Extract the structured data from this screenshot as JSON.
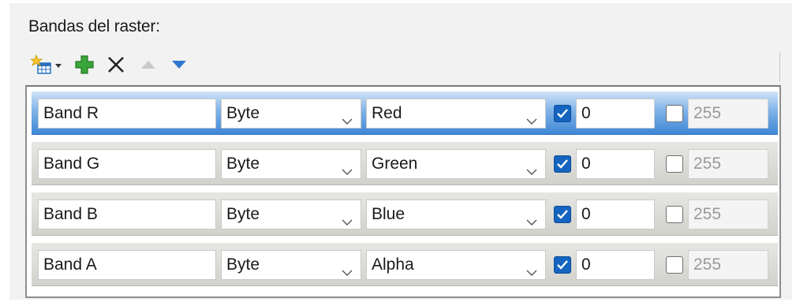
{
  "title": "Bandas del raster:",
  "toolbar": {
    "buttons": [
      {
        "name": "add-band-dropdown",
        "icon": "new-item-icon"
      },
      {
        "name": "add",
        "icon": "green-plus-icon"
      },
      {
        "name": "delete",
        "icon": "close-x-icon"
      },
      {
        "name": "move-up",
        "icon": "triangle-up-icon"
      },
      {
        "name": "move-down",
        "icon": "triangle-down-icon"
      }
    ]
  },
  "bands": [
    {
      "name": "Band R",
      "type": "Byte",
      "color": "Red",
      "nodata_min_checked": true,
      "nodata_min": "0",
      "nodata_max_checked": false,
      "nodata_max": "255",
      "selected": true
    },
    {
      "name": "Band G",
      "type": "Byte",
      "color": "Green",
      "nodata_min_checked": true,
      "nodata_min": "0",
      "nodata_max_checked": false,
      "nodata_max": "255",
      "selected": false
    },
    {
      "name": "Band B",
      "type": "Byte",
      "color": "Blue",
      "nodata_min_checked": true,
      "nodata_min": "0",
      "nodata_max_checked": false,
      "nodata_max": "255",
      "selected": false
    },
    {
      "name": "Band A",
      "type": "Byte",
      "color": "Alpha",
      "nodata_min_checked": true,
      "nodata_min": "0",
      "nodata_max_checked": false,
      "nodata_max": "255",
      "selected": false
    }
  ],
  "colors": {
    "selected_row": "#3f87d6",
    "checkbox_on": "#1565c0",
    "plus_green": "#3aa53a",
    "arrow_blue": "#2f78d0"
  }
}
